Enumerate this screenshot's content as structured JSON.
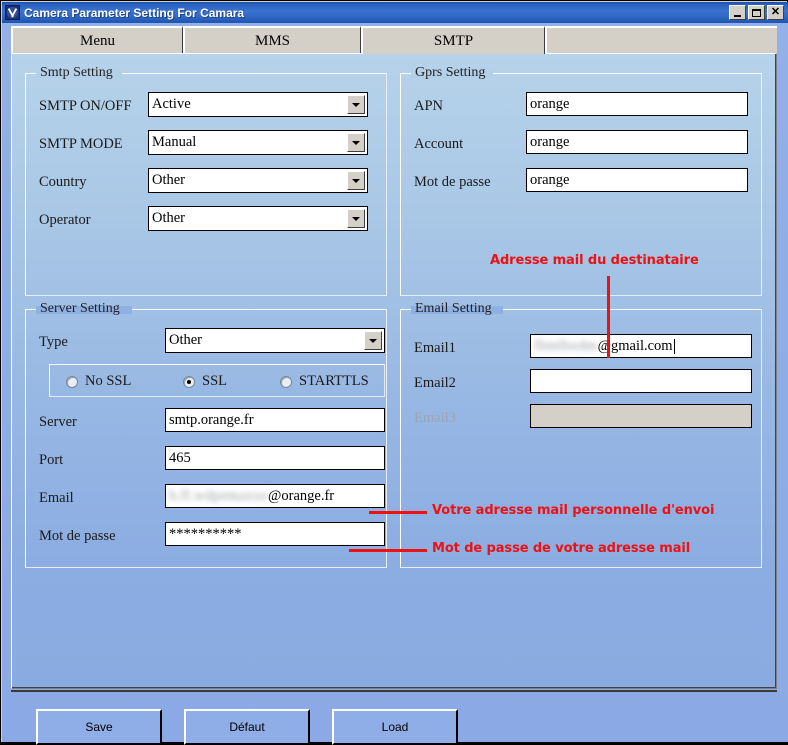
{
  "window": {
    "title": "Camera Parameter Setting For  Camara",
    "icon": "app-icon",
    "buttons": {
      "minimize": "minimize-button",
      "maximize": "maximize-button",
      "close": "close-button",
      "close_glyph": "✕"
    }
  },
  "tabs": [
    {
      "label": "Menu",
      "selected": false
    },
    {
      "label": "MMS",
      "selected": false
    },
    {
      "label": "SMTP",
      "selected": true
    }
  ],
  "smtp_setting": {
    "title": "Smtp Setting",
    "fields": [
      {
        "label": "SMTP ON/OFF",
        "value": "Active"
      },
      {
        "label": "SMTP MODE",
        "value": "Manual"
      },
      {
        "label": "Country",
        "value": "Other"
      },
      {
        "label": "Operator",
        "value": "Other"
      }
    ]
  },
  "gprs_setting": {
    "title": "Gprs Setting",
    "fields": [
      {
        "label": "APN",
        "value": "orange"
      },
      {
        "label": "Account",
        "value": "orange"
      },
      {
        "label": "Mot de passe",
        "value": "orange"
      }
    ]
  },
  "server_setting": {
    "title": "Server Setting",
    "type_label": "Type",
    "type_value": "Other",
    "ssl_options": [
      {
        "label": "No SSL",
        "selected": false
      },
      {
        "label": "SSL",
        "selected": true
      },
      {
        "label": "STARTTLS",
        "selected": false
      }
    ],
    "fields": [
      {
        "label": "Server",
        "value": "smtp.orange.fr"
      },
      {
        "label": "Port",
        "value": "465"
      },
      {
        "label": "Email",
        "value_redacted": "h.fl.wdpemaxxe",
        "value_suffix": "@orange.fr"
      },
      {
        "label": "Mot de passe",
        "value": "**********"
      }
    ]
  },
  "email_setting": {
    "title": "Email Setting",
    "fields": [
      {
        "label": "Email1",
        "value_redacted": "fbmlbxdm",
        "value_suffix": "@gmail.com",
        "disabled": false,
        "focused": true
      },
      {
        "label": "Email2",
        "value": "",
        "disabled": false,
        "focused": false
      },
      {
        "label": "Email3",
        "value": "",
        "disabled": true,
        "focused": false
      }
    ]
  },
  "annotations": [
    {
      "text": "Adresse mail du destinataire"
    },
    {
      "text": "Votre adresse mail personnelle d'envoi"
    },
    {
      "text": "Mot de passe de votre adresse mail"
    }
  ],
  "footer": {
    "buttons": [
      {
        "label": "Save"
      },
      {
        "label": "Défaut"
      },
      {
        "label": "Load"
      }
    ]
  },
  "colors": {
    "annotation": "#ee1111",
    "titlebar": "#2a62c0",
    "panel": "#8fade6",
    "tab_face": "#d4d0c8"
  }
}
